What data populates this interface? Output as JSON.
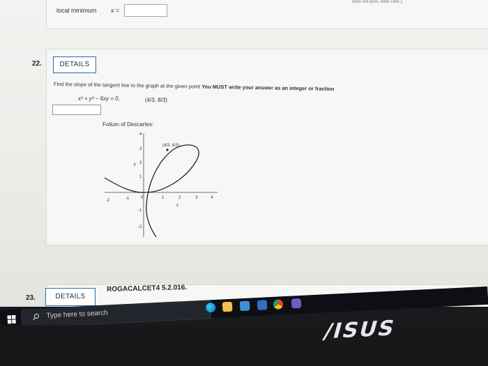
{
  "prev_question": {
    "label": "local minimum",
    "var_label": "x =",
    "top_hint": "does not exist, enter DNE.)"
  },
  "question_22": {
    "number": "22.",
    "details_label": "DETAILS",
    "prompt_text": "Find the slope of the tangent line to the graph at the given point ",
    "prompt_emphasis": "You MUST write your answer as an integer or fraction",
    "equation": "x³ + y³ − 6xy = 0,",
    "point": "(4/3, 8/3)",
    "graph_title": "Folium of Descartes:",
    "graph": {
      "point_label": "(4/3, 8/3)",
      "y_axis_label": "y",
      "x_axis_label": "x",
      "x_ticks": [
        "-2",
        "-1",
        "0",
        "1",
        "2",
        "3",
        "4"
      ],
      "y_ticks": [
        "4",
        "3",
        "2",
        "1",
        "-1",
        "-2"
      ]
    }
  },
  "question_23": {
    "number": "23.",
    "details_label": "DETAILS",
    "code": "ROGACALCET4 5.2.016."
  },
  "taskbar": {
    "search_placeholder": "Type here to search"
  },
  "brand": {
    "logo_text": "/ISUS"
  }
}
